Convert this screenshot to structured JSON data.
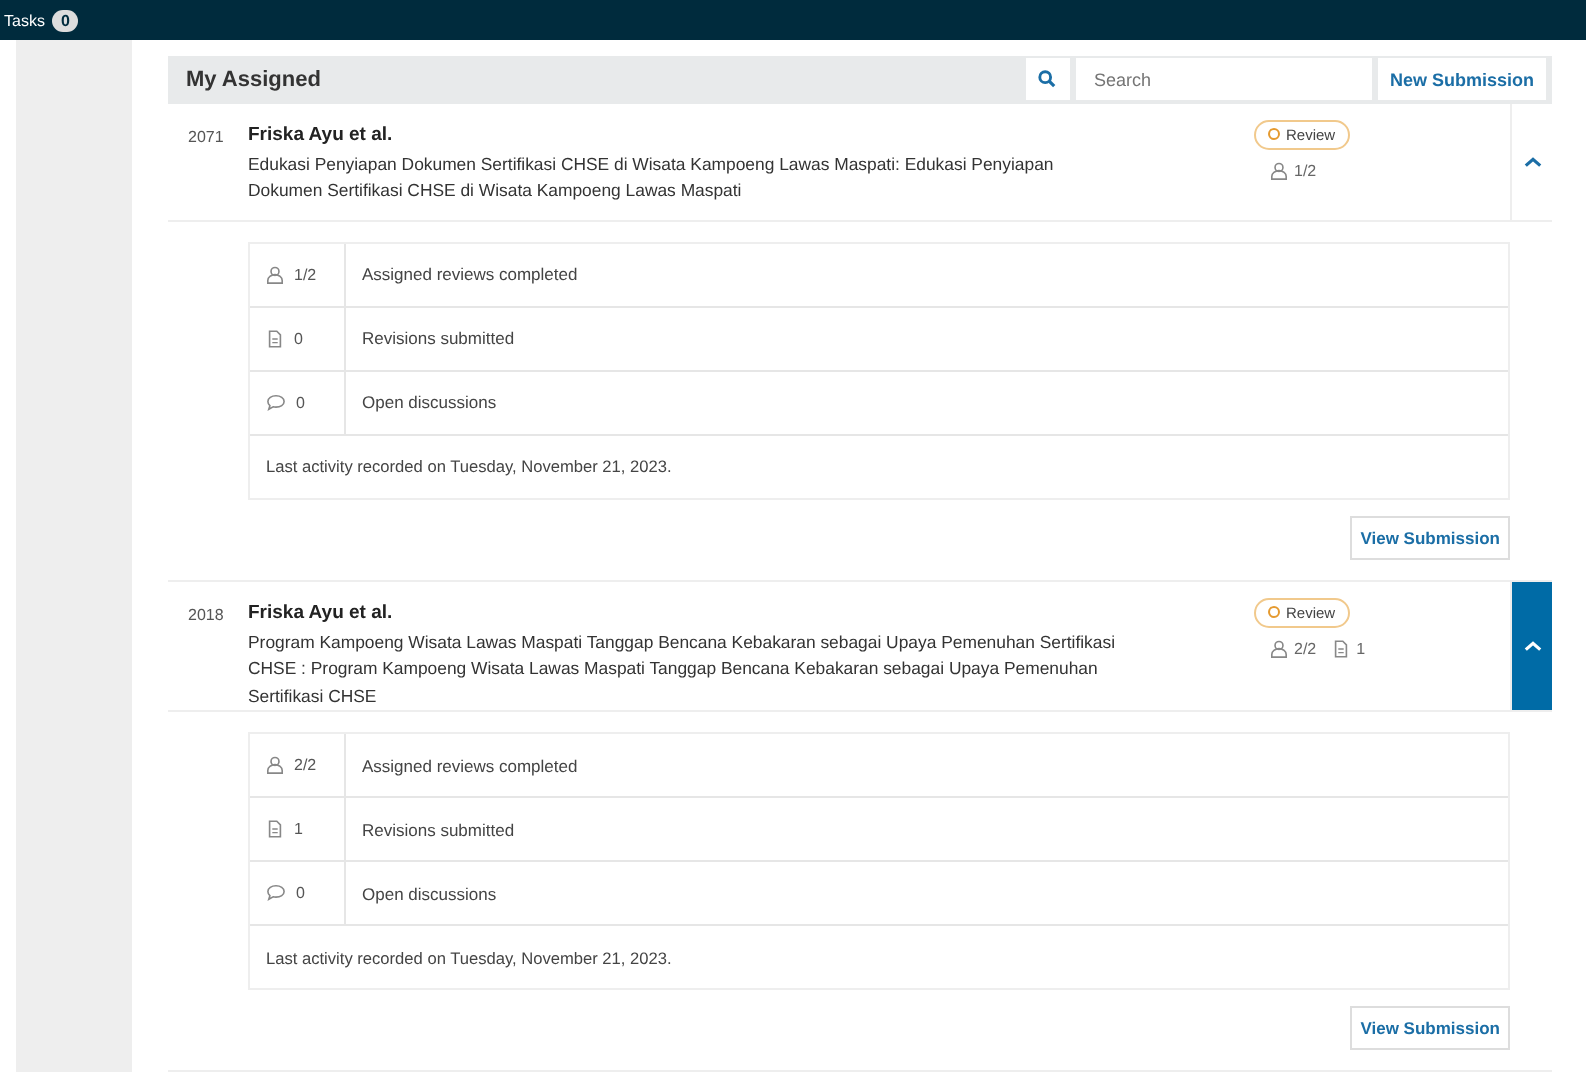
{
  "topbar": {
    "tasks_label": "Tasks",
    "tasks_count": "0"
  },
  "panel": {
    "title": "My Assigned",
    "search": {
      "placeholder": "Search"
    },
    "new_button": "New Submission"
  },
  "submissions": [
    {
      "id": "2071",
      "authors": "Friska Ayu et al.",
      "title": "Edukasi Penyiapan Dokumen Sertifikasi CHSE di Wisata Kampoeng Lawas Maspati: Edukasi Penyiapan Dokumen Sertifikasi CHSE di Wisata Kampoeng Lawas Maspati",
      "status": "Review",
      "stats": [
        {
          "kind": "reviews",
          "value": "1/2"
        }
      ],
      "expanded": true,
      "highlighted": false,
      "details": [
        {
          "kind": "reviews",
          "value": "1/2",
          "label": "Assigned reviews completed"
        },
        {
          "kind": "revisions",
          "value": "0",
          "label": "Revisions submitted"
        },
        {
          "kind": "discussions",
          "value": "0",
          "label": "Open discussions"
        }
      ],
      "last_activity": "Last activity recorded on Tuesday, November 21, 2023.",
      "view_button": "View Submission"
    },
    {
      "id": "2018",
      "authors": "Friska Ayu et al.",
      "title": "Program Kampoeng Wisata Lawas Maspati Tanggap Bencana Kebakaran sebagai Upaya Pemenuhan Sertifikasi CHSE : Program Kampoeng Wisata Lawas Maspati Tanggap Bencana Kebakaran sebagai Upaya Pemenuhan Sertifikasi CHSE",
      "status": "Review",
      "stats": [
        {
          "kind": "reviews",
          "value": "2/2"
        },
        {
          "kind": "revisions",
          "value": "1"
        }
      ],
      "expanded": true,
      "highlighted": true,
      "details": [
        {
          "kind": "reviews",
          "value": "2/2",
          "label": "Assigned reviews completed"
        },
        {
          "kind": "revisions",
          "value": "1",
          "label": "Revisions submitted"
        },
        {
          "kind": "discussions",
          "value": "0",
          "label": "Open discussions"
        }
      ],
      "last_activity": "Last activity recorded on Tuesday, November 21, 2023.",
      "view_button": "View Submission"
    }
  ]
}
